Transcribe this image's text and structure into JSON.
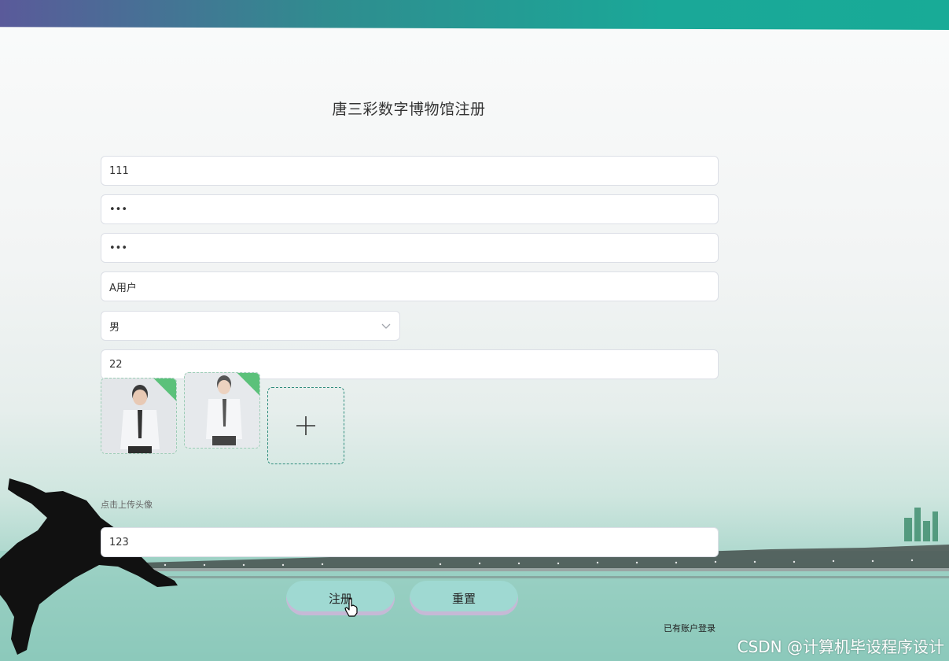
{
  "page": {
    "title": "唐三彩数字博物馆注册"
  },
  "form": {
    "account": "111",
    "password": "•••",
    "password_confirm": "•••",
    "name": "A用户",
    "gender": "男",
    "age": "22",
    "upload_hint": "点击上传头像",
    "phone": "123"
  },
  "buttons": {
    "register": "注册",
    "reset": "重置"
  },
  "links": {
    "login": "已有账户登录"
  },
  "watermark": "CSDN @计算机毕设程序设计",
  "colors": {
    "accent": "#1aa898",
    "button": "#9fd9d2",
    "upload_border": "#2f8d7d",
    "corner_badge": "#5bc17a"
  },
  "icons": {
    "select": "chevron-down-icon",
    "upload": "plus-icon",
    "uploaded_badge": "check-corner-icon"
  }
}
